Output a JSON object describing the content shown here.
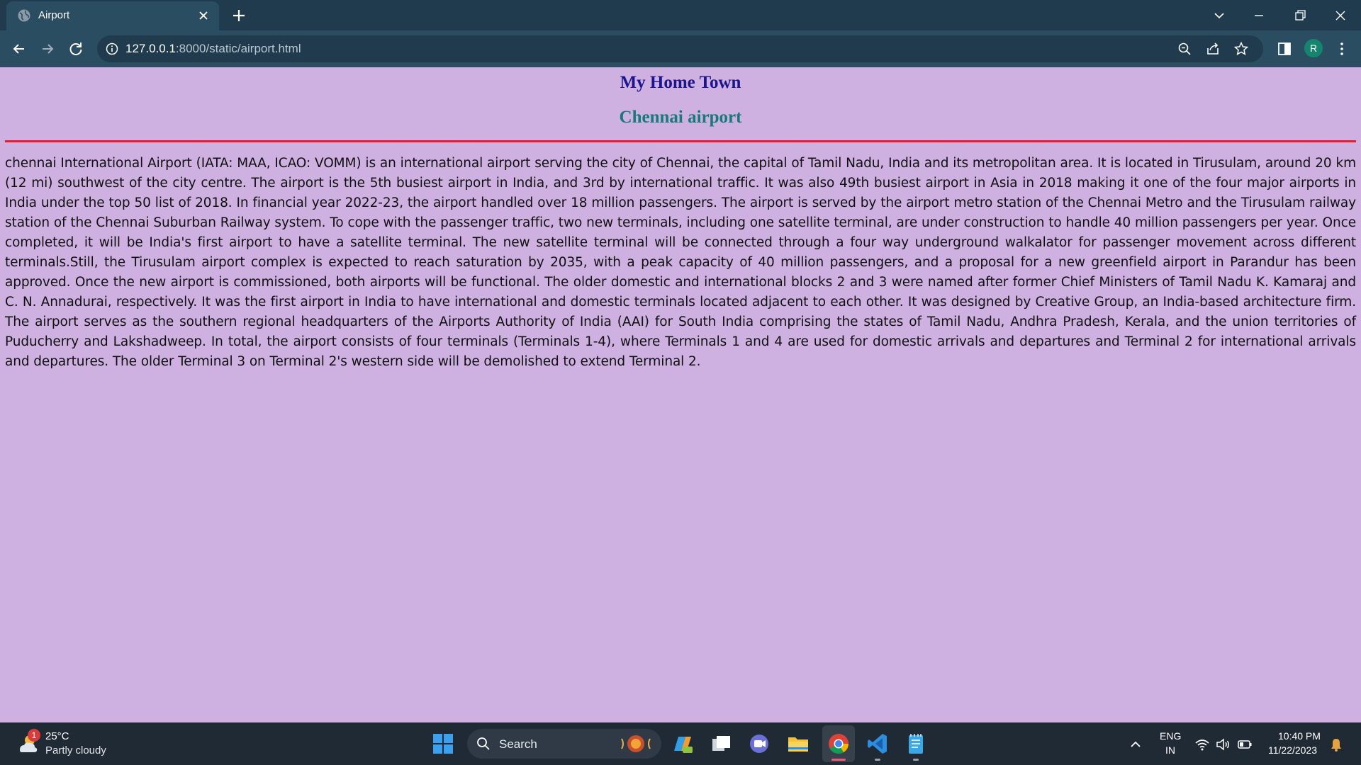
{
  "browser": {
    "tab_title": "Airport",
    "url_host": "127.0.0.1",
    "url_rest": ":8000/static/airport.html",
    "profile_initial": "R",
    "theme_color": "#1f3b4d"
  },
  "page": {
    "heading": "My Home Town",
    "subheading": "Chennai airport",
    "background_color": "#cfb1e1",
    "heading_color": "#1c1590",
    "subheading_color": "#177a7a",
    "rule_color": "#ee1b2a",
    "paragraph": "chennai International Airport (IATA: MAA, ICAO: VOMM) is an international airport serving the city of Chennai, the capital of Tamil Nadu, India and its metropolitan area. It is located in Tirusulam, around 20 km (12 mi) southwest of the city centre. The airport is the 5th busiest airport in India, and 3rd by international traffic. It was also 49th busiest airport in Asia in 2018 making it one of the four major airports in India under the top 50 list of 2018. In financial year 2022-23, the airport handled over 18 million passengers. The airport is served by the airport metro station of the Chennai Metro and the Tirusulam railway station of the Chennai Suburban Railway system. To cope with the passenger traffic, two new terminals, including one satellite terminal, are under construction to handle 40 million passengers per year. Once completed, it will be India's first airport to have a satellite terminal. The new satellite terminal will be connected through a four way underground walkalator for passenger movement across different terminals.Still, the Tirusulam airport complex is expected to reach saturation by 2035, with a peak capacity of 40 million passengers, and a proposal for a new greenfield airport in Parandur has been approved. Once the new airport is commissioned, both airports will be functional. The older domestic and international blocks 2 and 3 were named after former Chief Ministers of Tamil Nadu K. Kamaraj and C. N. Annadurai, respectively. It was the first airport in India to have international and domestic terminals located adjacent to each other. It was designed by Creative Group, an India-based architecture firm. The airport serves as the southern regional headquarters of the Airports Authority of India (AAI) for South India comprising the states of Tamil Nadu, Andhra Pradesh, Kerala, and the union territories of Puducherry and Lakshadweep. In total, the airport consists of four terminals (Terminals 1-4), where Terminals 1 and 4 are used for domestic arrivals and departures and Terminal 2 for international arrivals and departures. The older Terminal 3 on Terminal 2's western side will be demolished to extend Terminal 2."
  },
  "taskbar": {
    "weather_temp": "25°C",
    "weather_condition": "Partly cloudy",
    "weather_badge": "1",
    "search_label": "Search",
    "language": "ENG",
    "region": "IN",
    "time": "10:40 PM",
    "date": "11/22/2023",
    "apps": [
      "copilot-icon",
      "task-view-icon",
      "teams-chat-icon",
      "file-explorer-icon",
      "chrome-icon",
      "vscode-icon",
      "notepad-icon"
    ]
  }
}
